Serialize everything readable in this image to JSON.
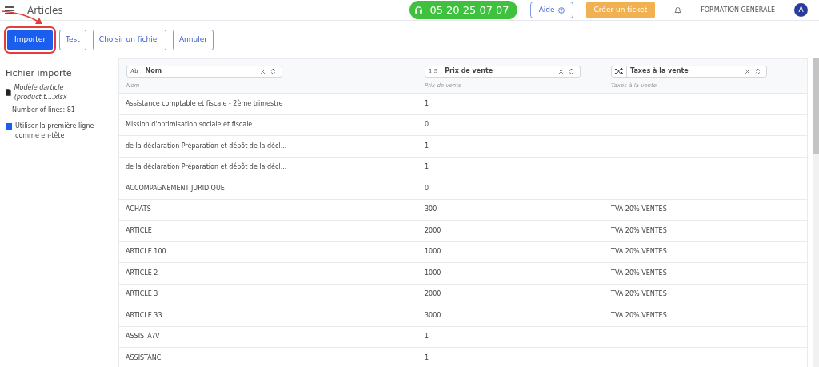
{
  "header": {
    "title": "Articles",
    "phone": "05 20 25 07 07",
    "help": "Aide",
    "ticket": "Créer un ticket",
    "company": "FORMATION GENERALE",
    "avatar": "A"
  },
  "actions": [
    {
      "label": "Importer",
      "primary": true,
      "highlighted": true
    },
    {
      "label": "Test",
      "primary": false,
      "highlighted": false
    },
    {
      "label": "Choisir un fichier",
      "primary": false,
      "highlighted": false
    },
    {
      "label": "Annuler",
      "primary": false,
      "highlighted": false
    }
  ],
  "sidebar": {
    "title": "Fichier importé",
    "file": "Modèle darticle (product.t....xlsx",
    "lines": "Number of lines: 81",
    "header_option": {
      "label": "Utiliser la première ligne comme en-tête",
      "checked": true
    }
  },
  "columns": [
    {
      "kind": "text",
      "prefix": "Ab",
      "field": "Nom",
      "hint": "Nom"
    },
    {
      "kind": "number",
      "prefix": "1.5",
      "field": "Prix de vente",
      "hint": "Prix de vente"
    },
    {
      "kind": "relation",
      "field": "Taxes à la vente",
      "hint": "Taxes à la vente"
    }
  ],
  "rows": [
    [
      "Assistance comptable et fiscale - 2ème trimestre",
      "1",
      ""
    ],
    [
      "Mission d'optimisation sociale et fiscale",
      "0",
      ""
    ],
    [
      "de la déclaration Préparation et dépôt de la décl...",
      "1",
      ""
    ],
    [
      "de la déclaration Préparation et dépôt de la décl...",
      "1",
      ""
    ],
    [
      "ACCOMPAGNEMENT JURIDIQUE",
      "0",
      ""
    ],
    [
      "ACHATS",
      "300",
      "TVA 20% VENTES"
    ],
    [
      "ARTICLE",
      "2000",
      "TVA 20% VENTES"
    ],
    [
      "ARTICLE 100",
      "1000",
      "TVA 20% VENTES"
    ],
    [
      "ARTICLE 2",
      "1000",
      "TVA 20% VENTES"
    ],
    [
      "ARTICLE 3",
      "2000",
      "TVA 20% VENTES"
    ],
    [
      "ARTICLE 33",
      "3000",
      "TVA 20% VENTES"
    ],
    [
      "ASSISTA?V",
      "1",
      ""
    ],
    [
      "ASSISTANC",
      "1",
      ""
    ]
  ]
}
